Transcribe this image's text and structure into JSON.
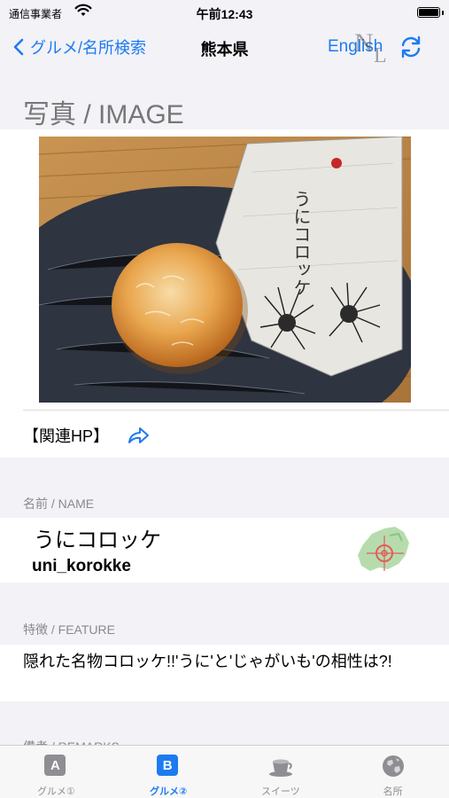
{
  "status_bar": {
    "carrier": "通信事業者",
    "time": "午前12:43"
  },
  "nav": {
    "back_label": "グルメ/名所検索",
    "title": "熊本県",
    "language_button": "English",
    "logo_n": "N",
    "logo_l": "L",
    "accent_color": "#1d7bf0"
  },
  "image_section": {
    "title": "写真 / IMAGE",
    "related_hp_label": "【関連HP】"
  },
  "name_section": {
    "caption": "名前 / NAME",
    "name_jp": "うにコロッケ",
    "name_en": "uni_korokke"
  },
  "feature_section": {
    "caption": "特徴 / FEATURE",
    "text": "隠れた名物コロッケ!!'うに'と'じゃがいも'の相性は?!"
  },
  "remarks_section": {
    "caption": "備考 / REMARKS"
  },
  "tabs": [
    {
      "label": "グルメ①",
      "icon": "A",
      "active": false
    },
    {
      "label": "グルメ②",
      "icon": "B",
      "active": true
    },
    {
      "label": "スイーツ",
      "icon": "coffee-cup",
      "active": false
    },
    {
      "label": "名所",
      "icon": "globe",
      "active": false
    }
  ],
  "photo_packaging_text": "うにコロッケ"
}
